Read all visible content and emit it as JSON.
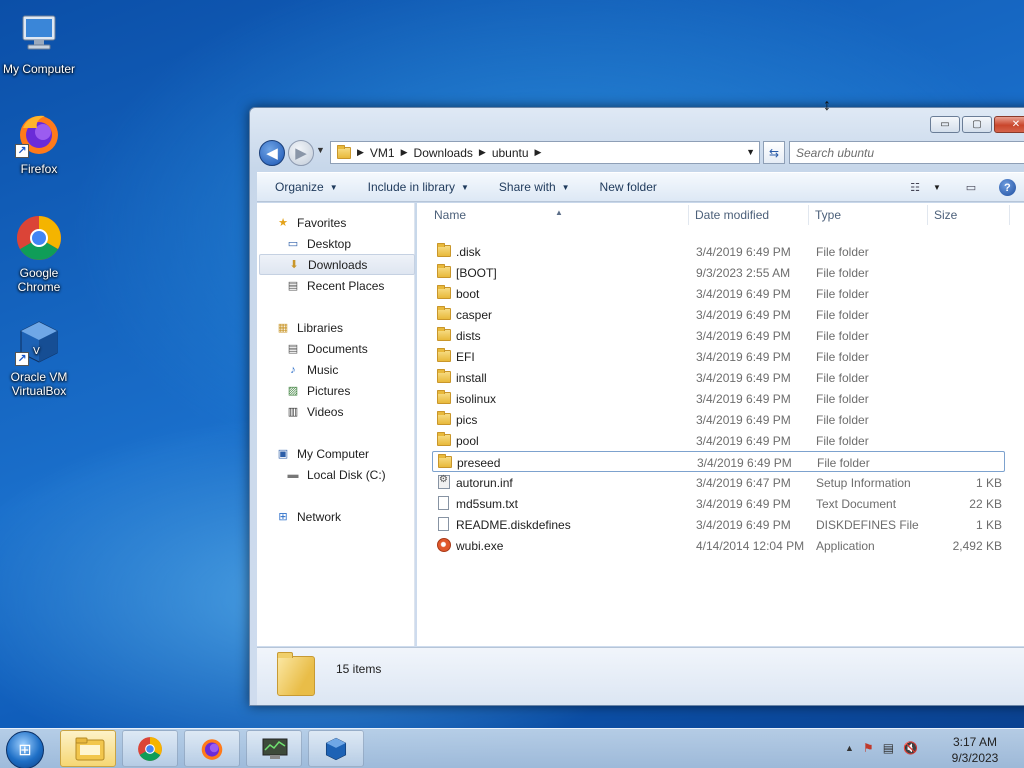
{
  "desktop": {
    "icons": [
      {
        "label": "My Computer",
        "icon": "computer-icon"
      },
      {
        "label": "Firefox",
        "icon": "firefox-icon"
      },
      {
        "label": "Google Chrome",
        "icon": "chrome-icon"
      },
      {
        "label": "Oracle VM VirtualBox",
        "icon": "virtualbox-icon"
      }
    ]
  },
  "window": {
    "caption": {
      "minimize": "▭",
      "maximize": "▢",
      "close": "✕"
    },
    "nav": {
      "back_glyph": "◀",
      "forward_glyph": "▶",
      "history_glyph": "▼"
    },
    "breadcrumb": [
      "VM1",
      "Downloads",
      "ubuntu"
    ],
    "breadcrumb_sep": "▶",
    "address_dropdown": "▼",
    "refresh_glyph": "⇆",
    "search": {
      "placeholder": "Search ubuntu",
      "icon_glyph": "⌕"
    },
    "commands": [
      {
        "label": "Organize",
        "dropdown": "▼"
      },
      {
        "label": "Include in library",
        "dropdown": "▼"
      },
      {
        "label": "Share with",
        "dropdown": "▼"
      },
      {
        "label": "New folder",
        "dropdown": ""
      }
    ],
    "view_glyph": "☷",
    "view_dropdown": "▼",
    "preview_glyph": "▭",
    "help_glyph": "?",
    "sidebar": {
      "favorites": {
        "label": "Favorites",
        "glyph": "★"
      },
      "favorite_items": [
        {
          "label": "Desktop",
          "glyph": "▭"
        },
        {
          "label": "Downloads",
          "glyph": "⬇",
          "selected": true
        },
        {
          "label": "Recent Places",
          "glyph": "▤"
        }
      ],
      "libraries": {
        "label": "Libraries",
        "glyph": "▦"
      },
      "library_items": [
        {
          "label": "Documents",
          "glyph": "▤"
        },
        {
          "label": "Music",
          "glyph": "♪"
        },
        {
          "label": "Pictures",
          "glyph": "▨"
        },
        {
          "label": "Videos",
          "glyph": "▥"
        }
      ],
      "computer": {
        "label": "My Computer",
        "glyph": "▣"
      },
      "computer_items": [
        {
          "label": "Local Disk (C:)",
          "glyph": "▬"
        }
      ],
      "network": {
        "label": "Network",
        "glyph": "⊞"
      }
    },
    "columns": {
      "name": "Name",
      "date": "Date modified",
      "type": "Type",
      "size": "Size",
      "sort_glyph": "▲"
    },
    "files": [
      {
        "name": ".disk",
        "date": "3/4/2019 6:49 PM",
        "type": "File folder",
        "size": "",
        "kind": "folder"
      },
      {
        "name": "[BOOT]",
        "date": "9/3/2023 2:55 AM",
        "type": "File folder",
        "size": "",
        "kind": "folder"
      },
      {
        "name": "boot",
        "date": "3/4/2019 6:49 PM",
        "type": "File folder",
        "size": "",
        "kind": "folder"
      },
      {
        "name": "casper",
        "date": "3/4/2019 6:49 PM",
        "type": "File folder",
        "size": "",
        "kind": "folder"
      },
      {
        "name": "dists",
        "date": "3/4/2019 6:49 PM",
        "type": "File folder",
        "size": "",
        "kind": "folder"
      },
      {
        "name": "EFI",
        "date": "3/4/2019 6:49 PM",
        "type": "File folder",
        "size": "",
        "kind": "folder"
      },
      {
        "name": "install",
        "date": "3/4/2019 6:49 PM",
        "type": "File folder",
        "size": "",
        "kind": "folder"
      },
      {
        "name": "isolinux",
        "date": "3/4/2019 6:49 PM",
        "type": "File folder",
        "size": "",
        "kind": "folder"
      },
      {
        "name": "pics",
        "date": "3/4/2019 6:49 PM",
        "type": "File folder",
        "size": "",
        "kind": "folder"
      },
      {
        "name": "pool",
        "date": "3/4/2019 6:49 PM",
        "type": "File folder",
        "size": "",
        "kind": "folder"
      },
      {
        "name": "preseed",
        "date": "3/4/2019 6:49 PM",
        "type": "File folder",
        "size": "",
        "kind": "folder",
        "selected": true
      },
      {
        "name": "autorun.inf",
        "date": "3/4/2019 6:47 PM",
        "type": "Setup Information",
        "size": "1 KB",
        "kind": "inf"
      },
      {
        "name": "md5sum.txt",
        "date": "3/4/2019 6:49 PM",
        "type": "Text Document",
        "size": "22 KB",
        "kind": "doc"
      },
      {
        "name": "README.diskdefines",
        "date": "3/4/2019 6:49 PM",
        "type": "DISKDEFINES File",
        "size": "1 KB",
        "kind": "doc"
      },
      {
        "name": "wubi.exe",
        "date": "4/14/2014 12:04 PM",
        "type": "Application",
        "size": "2,492 KB",
        "kind": "exe"
      }
    ],
    "item_count": "15 items"
  },
  "taskbar": {
    "start_glyph": "⊞",
    "buttons": [
      {
        "name": "explorer-taskbar-button",
        "icon": "folder-icon",
        "active": true
      },
      {
        "name": "chrome-taskbar-button",
        "icon": "chrome-icon",
        "active": false
      },
      {
        "name": "firefox-taskbar-button",
        "icon": "firefox-icon",
        "active": false
      },
      {
        "name": "taskmanager-taskbar-button",
        "icon": "monitor-icon",
        "active": false
      },
      {
        "name": "virtualbox-taskbar-button",
        "icon": "virtualbox-icon",
        "active": false
      }
    ],
    "tray": {
      "show_hidden": "▲",
      "flag": "⚑",
      "network": "▤",
      "volume": "🔇"
    },
    "clock": {
      "time": "3:17 AM",
      "date": "9/3/2023"
    }
  },
  "cursor_glyph": "↕",
  "colors": {
    "selection_border": "#7da2ce",
    "window_frame": "#c7d7ea",
    "desktop": "#1a6fcb"
  }
}
